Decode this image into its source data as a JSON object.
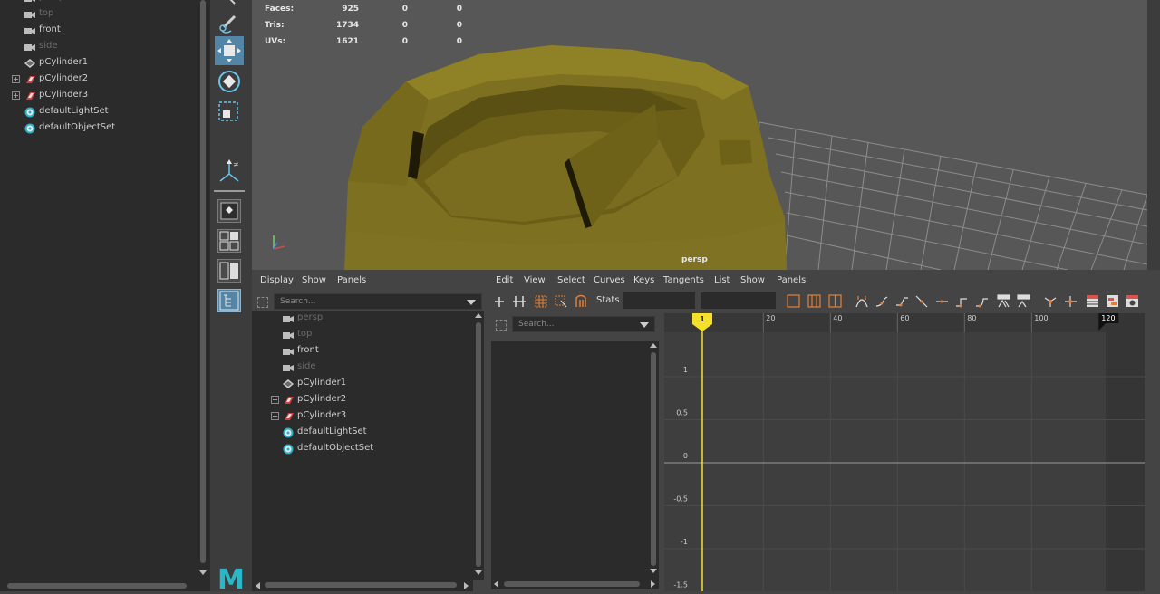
{
  "left_outliner": {
    "items": [
      {
        "label": "persp",
        "state": "dim",
        "icon": "camera-icon",
        "expandable": false
      },
      {
        "label": "top",
        "state": "dim",
        "icon": "camera-icon",
        "expandable": false
      },
      {
        "label": "front",
        "state": "normal",
        "icon": "camera-icon",
        "expandable": false
      },
      {
        "label": "side",
        "state": "dim",
        "icon": "camera-icon",
        "expandable": false
      },
      {
        "label": "pCylinder1",
        "state": "normal",
        "icon": "mesh-icon",
        "expandable": false
      },
      {
        "label": "pCylinder2",
        "state": "normal",
        "icon": "group-icon",
        "expandable": true
      },
      {
        "label": "pCylinder3",
        "state": "normal",
        "icon": "group-icon",
        "expandable": true
      },
      {
        "label": "defaultLightSet",
        "state": "normal",
        "icon": "set-icon",
        "expandable": false
      },
      {
        "label": "defaultObjectSet",
        "state": "normal",
        "icon": "set-icon",
        "expandable": false
      }
    ]
  },
  "viewport": {
    "hud": [
      {
        "label": "Faces:",
        "values": [
          "925",
          "0",
          "0"
        ]
      },
      {
        "label": "Tris:",
        "values": [
          "1734",
          "0",
          "0"
        ]
      },
      {
        "label": "UVs:",
        "values": [
          "1621",
          "0",
          "0"
        ]
      }
    ],
    "camera_label": "persp",
    "colors": {
      "mesh": "#8a7c24",
      "background": "#575757",
      "grid": "#8a8a8a"
    }
  },
  "outliner_panel": {
    "menu": [
      "Display",
      "Show",
      "Panels"
    ],
    "search_placeholder": "Search...",
    "items": [
      {
        "label": "persp",
        "state": "dim",
        "icon": "camera-icon",
        "expandable": false
      },
      {
        "label": "top",
        "state": "dim",
        "icon": "camera-icon",
        "expandable": false
      },
      {
        "label": "front",
        "state": "normal",
        "icon": "camera-icon",
        "expandable": false
      },
      {
        "label": "side",
        "state": "dim",
        "icon": "camera-icon",
        "expandable": false
      },
      {
        "label": "pCylinder1",
        "state": "normal",
        "icon": "mesh-icon",
        "expandable": false
      },
      {
        "label": "pCylinder2",
        "state": "normal",
        "icon": "group-icon",
        "expandable": true
      },
      {
        "label": "pCylinder3",
        "state": "normal",
        "icon": "group-icon",
        "expandable": true
      },
      {
        "label": "defaultLightSet",
        "state": "normal",
        "icon": "set-icon",
        "expandable": false
      },
      {
        "label": "defaultObjectSet",
        "state": "normal",
        "icon": "set-icon",
        "expandable": false
      }
    ]
  },
  "graph_editor": {
    "menu": [
      "Edit",
      "View",
      "Select",
      "Curves",
      "Keys",
      "Tangents",
      "List",
      "Show",
      "Panels"
    ],
    "stats_label": "Stats",
    "search_placeholder": "Search...",
    "current_frame": "1",
    "end_frame": "120",
    "frame_ticks": [
      "20",
      "40",
      "60",
      "80",
      "100"
    ],
    "value_ticks": [
      "1",
      "0.5",
      "0",
      "-0.5",
      "-1",
      "-1.5"
    ],
    "colors": {
      "playhead": "#f5e12a",
      "accent": "#e0803a"
    }
  },
  "logo": "M"
}
